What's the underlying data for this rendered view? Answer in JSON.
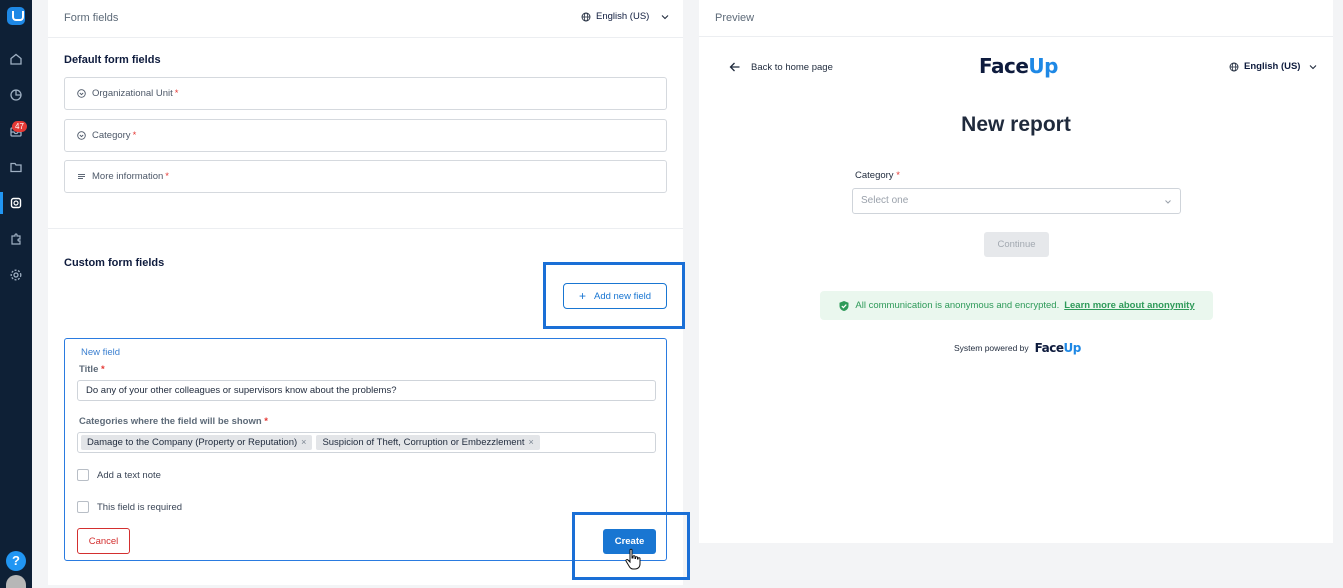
{
  "sidebar": {
    "badge_count": "47",
    "help_label": "?",
    "icons": [
      "home-icon",
      "analytics-icon",
      "inbox-icon",
      "folder-icon",
      "form-icon",
      "puzzle-icon",
      "settings-icon"
    ]
  },
  "form_fields": {
    "title": "Form fields",
    "language": "English (US)",
    "default_title": "Default form fields",
    "default_fields": [
      {
        "label": "Organizational Unit",
        "required": "*"
      },
      {
        "label": "Category",
        "required": "*"
      },
      {
        "label": "More information",
        "required": "*"
      }
    ],
    "custom_title": "Custom form fields",
    "add_new_field": "Add new field"
  },
  "new_field": {
    "legend": "New field",
    "title_label": "Title",
    "title_value": "Do any of your other colleagues or supervisors know about the problems?",
    "categories_label": "Categories where the field will be shown",
    "categories": [
      "Damage to the Company (Property or Reputation)",
      "Suspicion of Theft, Corruption or Embezzlement"
    ],
    "text_note_label": "Add a text note",
    "required_label": "This field is required",
    "cancel": "Cancel",
    "create": "Create",
    "required_mark": "*"
  },
  "preview": {
    "title": "Preview",
    "back": "Back to home page",
    "brand_pre": "Face",
    "brand_u": "Up",
    "language": "English (US)",
    "heading": "New report",
    "category_label": "Category",
    "required_mark": "*",
    "select_placeholder": "Select one",
    "continue": "Continue",
    "anon_text": "All communication is anonymous and encrypted.",
    "anon_link": "Learn more about anonymity",
    "powered_by": "System powered by"
  },
  "colors": {
    "sidebar": "#0e2036",
    "accent": "#1976d2",
    "danger": "#d32f2f",
    "success": "#2e9a59"
  }
}
